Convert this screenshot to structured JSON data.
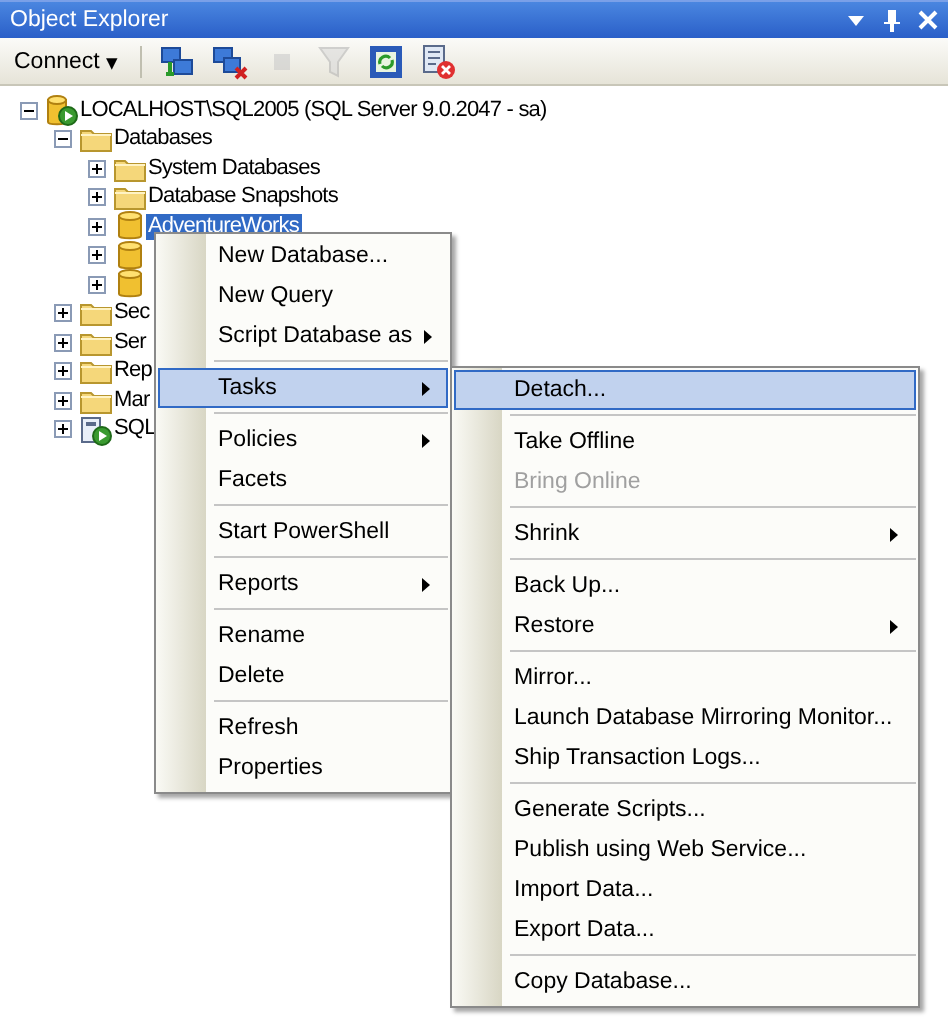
{
  "window": {
    "title": "Object Explorer"
  },
  "title_buttons": [
    {
      "kind": "dropdown"
    },
    {
      "kind": "pin"
    },
    {
      "kind": "close"
    }
  ],
  "toolbar": {
    "connect": {
      "label": "Connect",
      "caret": "▾"
    },
    "buttons": [
      {
        "kind": "connect",
        "disabled": false
      },
      {
        "kind": "disconnect",
        "disabled": false
      },
      {
        "kind": "stop",
        "disabled": true
      },
      {
        "kind": "filter",
        "disabled": true
      },
      {
        "kind": "refresh",
        "disabled": false
      },
      {
        "kind": "summary",
        "disabled": false
      }
    ]
  },
  "tree": [
    {
      "label": "LOCALHOST\\SQL2005 (SQL Server 9.0.2047 - sa)",
      "kind": "server",
      "expanded": true,
      "selected": false,
      "children": [
        {
          "label": "Databases",
          "kind": "folder",
          "expanded": true,
          "selected": false,
          "children": [
            {
              "label": "System Databases",
              "kind": "folder",
              "expanded": false,
              "selected": false
            },
            {
              "label": "Database Snapshots",
              "kind": "folder",
              "expanded": false,
              "selected": false
            },
            {
              "label": "AdventureWorks",
              "kind": "database",
              "expanded": false,
              "selected": true
            },
            {
              "kind": "database",
              "expanded": false,
              "selected": false
            },
            {
              "kind": "database",
              "expanded": false,
              "selected": false
            }
          ]
        },
        {
          "label": "Sec",
          "kind": "folder",
          "expanded": false,
          "selected": false
        },
        {
          "label": "Ser",
          "kind": "folder",
          "expanded": false,
          "selected": false
        },
        {
          "label": "Rep",
          "kind": "folder",
          "expanded": false,
          "selected": false
        },
        {
          "label": "Mar",
          "kind": "folder",
          "expanded": false,
          "selected": false
        },
        {
          "label": "SQL",
          "kind": "agent",
          "expanded": false,
          "selected": false
        }
      ]
    }
  ],
  "context_menu": [
    {
      "kind": "item",
      "label": "New Database...",
      "submenu": false,
      "selected": false,
      "disabled": false
    },
    {
      "kind": "item",
      "label": "New Query",
      "submenu": false,
      "selected": false,
      "disabled": false
    },
    {
      "kind": "item",
      "label": "Script Database as",
      "submenu": true,
      "selected": false,
      "disabled": false
    },
    {
      "kind": "separator"
    },
    {
      "kind": "item",
      "label": "Tasks",
      "submenu": true,
      "selected": true,
      "disabled": false
    },
    {
      "kind": "separator"
    },
    {
      "kind": "item",
      "label": "Policies",
      "submenu": true,
      "selected": false,
      "disabled": false
    },
    {
      "kind": "item",
      "label": "Facets",
      "submenu": false,
      "selected": false,
      "disabled": false
    },
    {
      "kind": "separator"
    },
    {
      "kind": "item",
      "label": "Start PowerShell",
      "submenu": false,
      "selected": false,
      "disabled": false
    },
    {
      "kind": "separator"
    },
    {
      "kind": "item",
      "label": "Reports",
      "submenu": true,
      "selected": false,
      "disabled": false
    },
    {
      "kind": "separator"
    },
    {
      "kind": "item",
      "label": "Rename",
      "submenu": false,
      "selected": false,
      "disabled": false
    },
    {
      "kind": "item",
      "label": "Delete",
      "submenu": false,
      "selected": false,
      "disabled": false
    },
    {
      "kind": "separator"
    },
    {
      "kind": "item",
      "label": "Refresh",
      "submenu": false,
      "selected": false,
      "disabled": false
    },
    {
      "kind": "item",
      "label": "Properties",
      "submenu": false,
      "selected": false,
      "disabled": false
    }
  ],
  "tasks_submenu": [
    {
      "kind": "item",
      "label": "Detach...",
      "submenu": false,
      "selected": true,
      "disabled": false
    },
    {
      "kind": "separator"
    },
    {
      "kind": "item",
      "label": "Take Offline",
      "submenu": false,
      "selected": false,
      "disabled": false
    },
    {
      "kind": "item",
      "label": "Bring Online",
      "submenu": false,
      "selected": false,
      "disabled": true
    },
    {
      "kind": "separator"
    },
    {
      "kind": "item",
      "label": "Shrink",
      "submenu": true,
      "selected": false,
      "disabled": false
    },
    {
      "kind": "separator"
    },
    {
      "kind": "item",
      "label": "Back Up...",
      "submenu": false,
      "selected": false,
      "disabled": false
    },
    {
      "kind": "item",
      "label": "Restore",
      "submenu": true,
      "selected": false,
      "disabled": false
    },
    {
      "kind": "separator"
    },
    {
      "kind": "item",
      "label": "Mirror...",
      "submenu": false,
      "selected": false,
      "disabled": false
    },
    {
      "kind": "item",
      "label": "Launch Database Mirroring Monitor...",
      "submenu": false,
      "selected": false,
      "disabled": false
    },
    {
      "kind": "item",
      "label": "Ship Transaction Logs...",
      "submenu": false,
      "selected": false,
      "disabled": false
    },
    {
      "kind": "separator"
    },
    {
      "kind": "item",
      "label": "Generate Scripts...",
      "submenu": false,
      "selected": false,
      "disabled": false
    },
    {
      "kind": "item",
      "label": "Publish using Web Service...",
      "submenu": false,
      "selected": false,
      "disabled": false
    },
    {
      "kind": "item",
      "label": "Import Data...",
      "submenu": false,
      "selected": false,
      "disabled": false
    },
    {
      "kind": "item",
      "label": "Export Data...",
      "submenu": false,
      "selected": false,
      "disabled": false
    },
    {
      "kind": "separator"
    },
    {
      "kind": "item",
      "label": "Copy Database...",
      "submenu": false,
      "selected": false,
      "disabled": false
    }
  ]
}
